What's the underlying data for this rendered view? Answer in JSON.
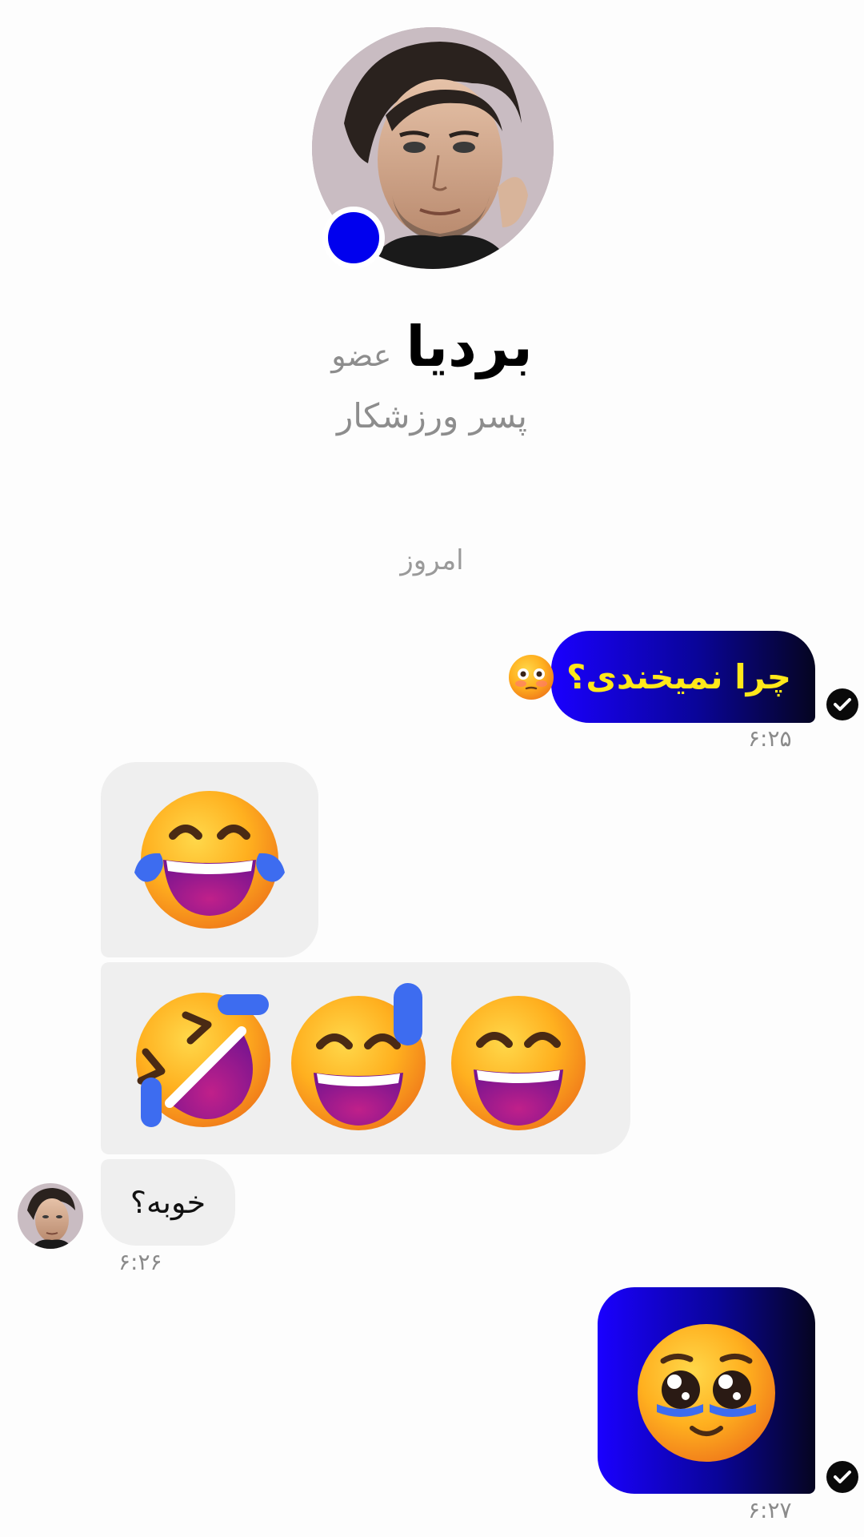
{
  "profile": {
    "name": "بردیا",
    "role": "عضو",
    "subtitle": "پسر ورزشکار",
    "online_color": "#0000ee"
  },
  "date_separator": "امروز",
  "messages": [
    {
      "direction": "outgoing",
      "text": "چرا نمیخندی؟",
      "emoji": "flushed-face",
      "time": "۶:۲۵",
      "status": "read"
    },
    {
      "direction": "incoming",
      "emojis": [
        "laughing-face-tears"
      ]
    },
    {
      "direction": "incoming",
      "emojis": [
        "rolling-on-floor-laughing",
        "grinning-face-sweat",
        "grinning-smiling-eyes"
      ]
    },
    {
      "direction": "incoming",
      "text": "خوبه؟",
      "time": "۶:۲۶"
    },
    {
      "direction": "outgoing",
      "emojis": [
        "face-holding-back-tears"
      ],
      "time": "۶:۲۷",
      "status": "read"
    }
  ],
  "colors": {
    "outgoing_gradient_start": "#1a00ff",
    "outgoing_gradient_end": "#050520",
    "outgoing_text": "#ffe81a",
    "incoming_bubble": "#efefef",
    "muted_text": "#8d8d8d"
  }
}
